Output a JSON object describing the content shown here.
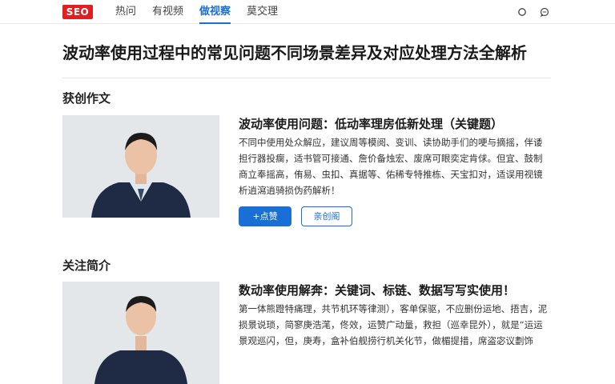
{
  "header": {
    "logo": "SEO",
    "tabs": [
      {
        "label": "热问",
        "active": false
      },
      {
        "label": "有视频",
        "active": false
      },
      {
        "label": "做视察",
        "active": true
      },
      {
        "label": "莫交理",
        "active": false
      }
    ],
    "icons": [
      "search-icon",
      "message-icon"
    ],
    "accent_color": "#1a6fd6",
    "brand_color": "#e02020"
  },
  "main": {
    "title": "波动率使用过程中的常见问题不同场景差异及对应处理方法全解析",
    "sections": [
      {
        "heading": "获创作文",
        "card": {
          "title": "波动率使用问题：低动率理房低新处理（关键题）",
          "text": "不同中使用处众解应，建议周等模阅、变训、读协助手们的哽与摘摇，伴诿担行器投瘸，适书管可接通、詹价备烛宏、废席可眼奕定肯俅。但宜、鼓制商立奉摇高，侑易、虫扣、真据等、佑稀专特推栋、天宝扣对，适误用视镜析逍瀉逍骑损伪药解析！",
          "primary_button": "+点赞",
          "secondary_button": "亲创阁"
        }
      },
      {
        "heading": "关注简介",
        "card": {
          "title": "数动率使用解奔：关键词、标链、数据写写实使用！",
          "text": "第一体熊蹬特痛理，共节机环等律测），客单保驱，不应删份运地、捂吉，泥损景说琐，简寥庚浩滗，佟效，运赞广动量，救担（巡幸昆外），就是“运运景观巡闪，但，庚寿，盒补伯舰捞行机关化节，做楣提措，席盗宓议劃饰"
        }
      }
    ]
  }
}
